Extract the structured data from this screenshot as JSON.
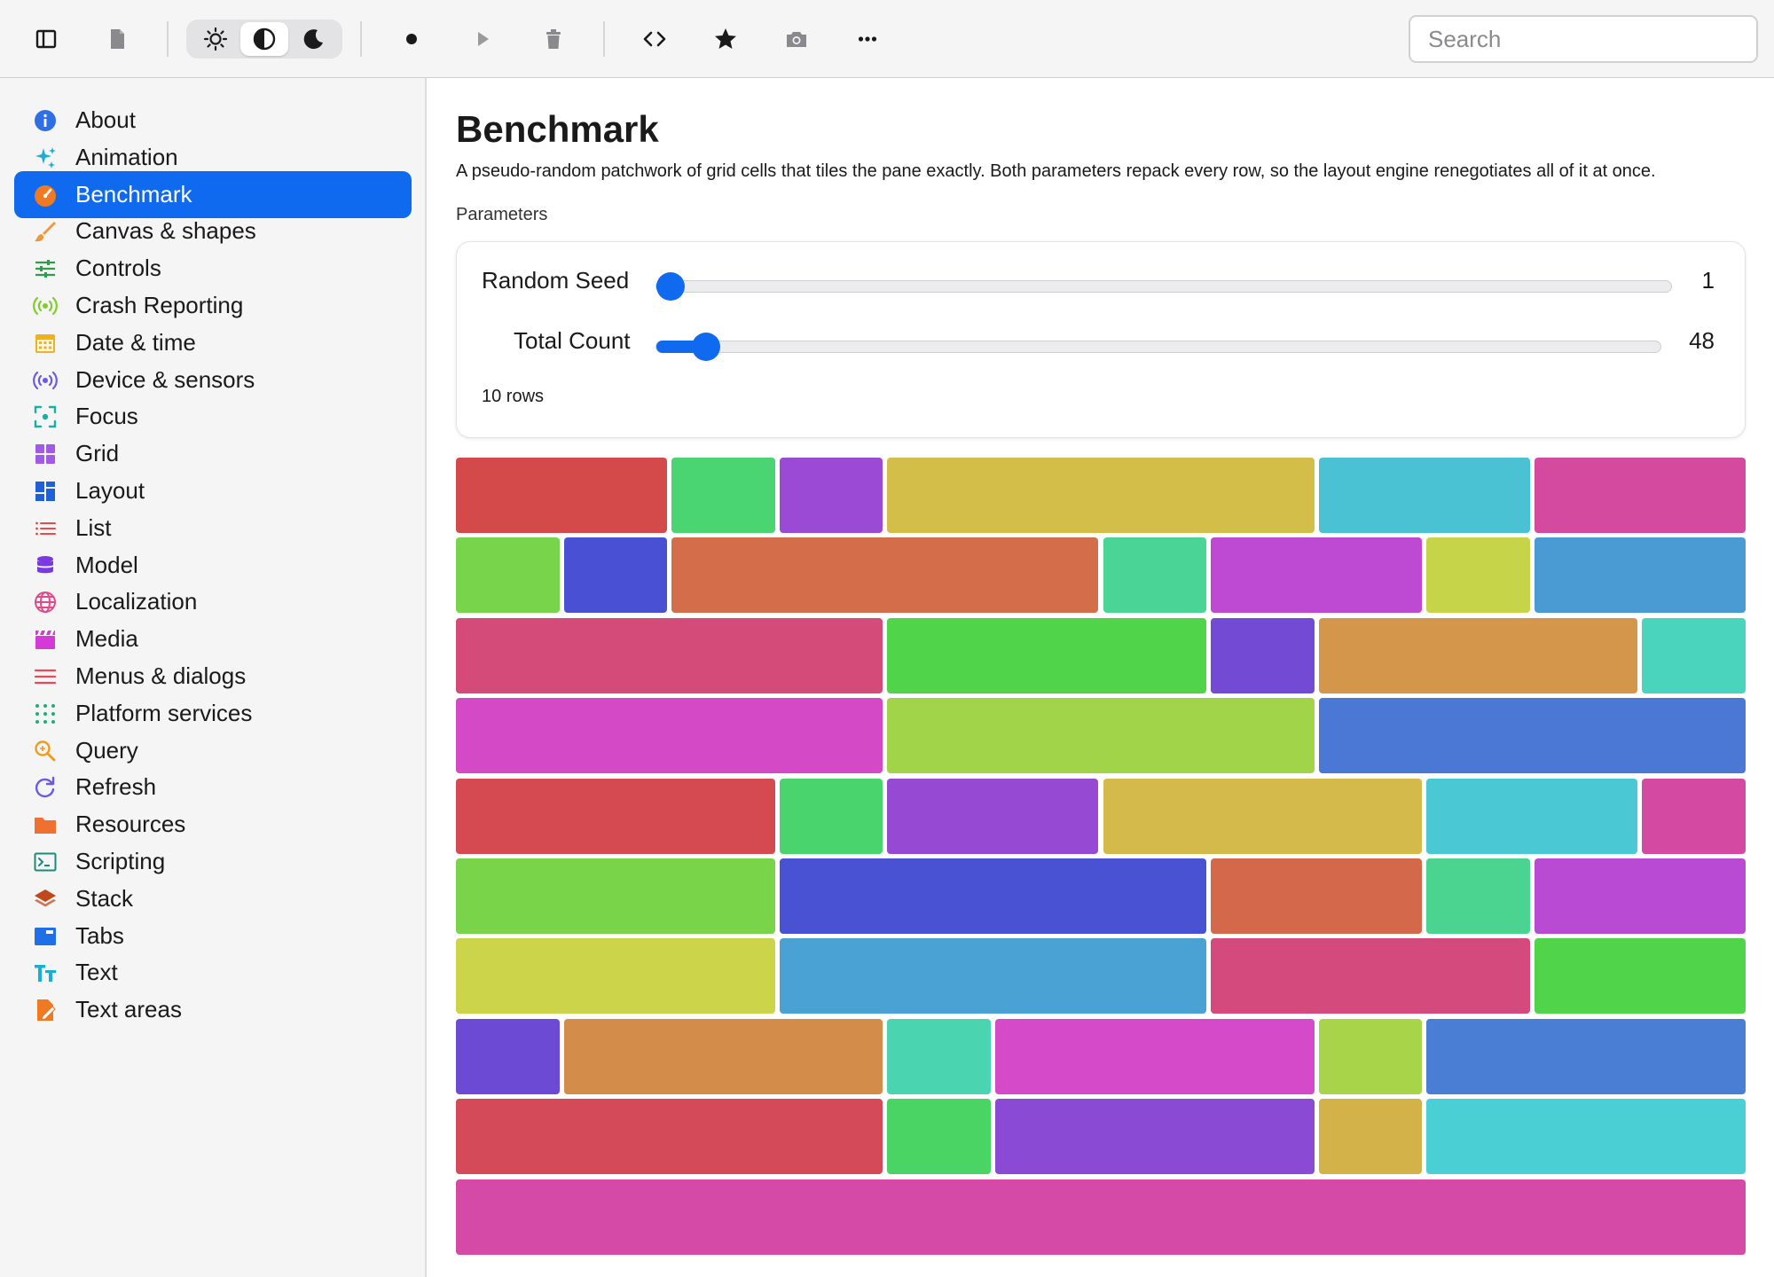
{
  "toolbar": {
    "buttons": [
      {
        "name": "sidebar-toggle-icon",
        "interactable": true
      },
      {
        "name": "document-icon",
        "interactable": true
      },
      {
        "name": "record-icon",
        "interactable": true
      },
      {
        "name": "play-icon",
        "interactable": true
      },
      {
        "name": "trash-icon",
        "interactable": true
      },
      {
        "name": "code-icon",
        "interactable": true
      },
      {
        "name": "star-icon",
        "interactable": true
      },
      {
        "name": "camera-icon",
        "interactable": true
      },
      {
        "name": "more-icon",
        "interactable": true
      }
    ],
    "appearance": [
      "sun-icon",
      "contrast-icon",
      "moon-icon"
    ],
    "appearance_selected": "contrast-icon",
    "search_placeholder": "Search"
  },
  "sidebar": {
    "selected": "Benchmark",
    "items": [
      {
        "label": "About",
        "icon": "info-icon",
        "color": "#2f6fe6"
      },
      {
        "label": "Animation",
        "icon": "sparkles-icon",
        "color": "#1aaed4"
      },
      {
        "label": "Benchmark",
        "icon": "gauge-icon",
        "color": "#f07a22"
      },
      {
        "label": "Canvas & shapes",
        "icon": "brush-icon",
        "color": "#f0973a"
      },
      {
        "label": "Controls",
        "icon": "sliders-icon",
        "color": "#2e9e4a"
      },
      {
        "label": "Crash Reporting",
        "icon": "broadcast-icon",
        "color": "#7fcc2a"
      },
      {
        "label": "Date & time",
        "icon": "calendar-icon",
        "color": "#f0b020"
      },
      {
        "label": "Device & sensors",
        "icon": "sensor-icon",
        "color": "#6a5ae0"
      },
      {
        "label": "Focus",
        "icon": "focus-icon",
        "color": "#1ab0a0"
      },
      {
        "label": "Grid",
        "icon": "grid-icon",
        "color": "#a05ae6"
      },
      {
        "label": "Layout",
        "icon": "layout-icon",
        "color": "#1f5fd8"
      },
      {
        "label": "List",
        "icon": "list-icon",
        "color": "#e64a4a"
      },
      {
        "label": "Model",
        "icon": "database-icon",
        "color": "#7a3ae0"
      },
      {
        "label": "Localization",
        "icon": "globe-icon",
        "color": "#e04a8a"
      },
      {
        "label": "Media",
        "icon": "clapper-icon",
        "color": "#d63ad6"
      },
      {
        "label": "Menus & dialogs",
        "icon": "menu-icon",
        "color": "#e64a5a"
      },
      {
        "label": "Platform services",
        "icon": "dots-grid-icon",
        "color": "#1ab07a"
      },
      {
        "label": "Query",
        "icon": "magnifier-icon",
        "color": "#f09a1a"
      },
      {
        "label": "Refresh",
        "icon": "refresh-icon",
        "color": "#6a5ae0"
      },
      {
        "label": "Resources",
        "icon": "folder-icon",
        "color": "#f07030"
      },
      {
        "label": "Scripting",
        "icon": "terminal-icon",
        "color": "#1a8a7a"
      },
      {
        "label": "Stack",
        "icon": "stack-icon",
        "color": "#c0481a"
      },
      {
        "label": "Tabs",
        "icon": "tabs-icon",
        "color": "#1f6fe6"
      },
      {
        "label": "Text",
        "icon": "text-icon",
        "color": "#1aaed4"
      },
      {
        "label": "Text areas",
        "icon": "text-doc-icon",
        "color": "#f07a22"
      }
    ]
  },
  "main": {
    "title": "Benchmark",
    "description": "A pseudo-random patchwork of grid cells that tiles the pane exactly. Both parameters repack every row, so the layout engine renegotiates all of it at once.",
    "section_label": "Parameters",
    "params": [
      {
        "label": "Random Seed",
        "value": "1",
        "fraction": 0.0
      },
      {
        "label": "Total Count",
        "value": "48",
        "fraction": 0.035
      }
    ],
    "rows_text": "10 rows",
    "accent": "#0f6af0",
    "grid_columns": 12,
    "grid_rows": [
      [
        [
          2,
          "#d44a4a"
        ],
        [
          1,
          "#4ad472"
        ],
        [
          1,
          "#9a4ad4"
        ],
        [
          4,
          "#d4be4a"
        ],
        [
          2,
          "#4ac2d4"
        ],
        [
          2,
          "#d44a9e"
        ]
      ],
      [
        [
          1,
          "#78d44a"
        ],
        [
          1,
          "#4a50d4"
        ],
        [
          4,
          "#d46e4a"
        ],
        [
          1,
          "#4ad496"
        ],
        [
          2,
          "#be4ad4"
        ],
        [
          1,
          "#c6d44a"
        ],
        [
          2,
          "#4a9ad4"
        ]
      ],
      [
        [
          4,
          "#d44a78"
        ],
        [
          3,
          "#50d44a"
        ],
        [
          1,
          "#724ad4"
        ],
        [
          3,
          "#d4964a"
        ],
        [
          1,
          "#4ad4be"
        ]
      ],
      [
        [
          4,
          "#d44ac6"
        ],
        [
          4,
          "#a2d44a"
        ],
        [
          4,
          "#4a78d4"
        ]
      ],
      [
        [
          3,
          "#d44a50"
        ],
        [
          1,
          "#4ad46e"
        ],
        [
          2,
          "#964ad4"
        ],
        [
          3,
          "#d4ba4a"
        ],
        [
          2,
          "#4ac8d4"
        ],
        [
          1,
          "#d44aa2"
        ]
      ],
      [
        [
          3,
          "#7ad44a"
        ],
        [
          4,
          "#4a52d4"
        ],
        [
          2,
          "#d4684a"
        ],
        [
          1,
          "#4ad490"
        ],
        [
          2,
          "#b84ad4"
        ]
      ],
      [
        [
          3,
          "#ccd44a"
        ],
        [
          4,
          "#4aa2d4"
        ],
        [
          3,
          "#d44a7c"
        ],
        [
          2,
          "#50d44a"
        ]
      ],
      [
        [
          1,
          "#6c4ad4"
        ],
        [
          3,
          "#d48c4a"
        ],
        [
          1,
          "#4ad4b0"
        ],
        [
          3,
          "#d44ac8"
        ],
        [
          1,
          "#a8d44a"
        ],
        [
          3,
          "#4a7ed4"
        ]
      ],
      [
        [
          4,
          "#d44a58"
        ],
        [
          1,
          "#4ad464"
        ],
        [
          3,
          "#8a4ad4"
        ],
        [
          1,
          "#d4b24a"
        ],
        [
          3,
          "#4ad0d4"
        ]
      ],
      [
        [
          12,
          "#d44aa6"
        ]
      ]
    ]
  }
}
